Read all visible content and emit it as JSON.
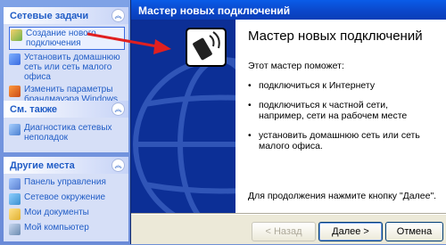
{
  "taskpane": {
    "network_tasks": {
      "title": "Сетевые задачи",
      "items": [
        {
          "label": "Создание нового подключения",
          "icon": "new-connection-icon"
        },
        {
          "label": "Установить домашнюю сеть или сеть малого офиса",
          "icon": "home-network-icon"
        },
        {
          "label": "Изменить параметры брандмауэра Windows",
          "icon": "firewall-icon"
        }
      ]
    },
    "see_also": {
      "title": "См. также",
      "items": [
        {
          "label": "Диагностика сетевых неполадок",
          "icon": "diagnostics-icon"
        }
      ]
    },
    "other_places": {
      "title": "Другие места",
      "items": [
        {
          "label": "Панель управления",
          "icon": "control-panel-icon"
        },
        {
          "label": "Сетевое окружение",
          "icon": "network-places-icon"
        },
        {
          "label": "Мои документы",
          "icon": "my-documents-icon"
        },
        {
          "label": "Мой компьютер",
          "icon": "my-computer-icon"
        }
      ]
    }
  },
  "wizard": {
    "window_title": "Мастер новых подключений",
    "heading": "Мастер новых подключений",
    "intro": "Этот мастер поможет:",
    "bullets": [
      "подключиться к Интернету",
      "подключиться к частной сети, например, сети на рабочем месте",
      "установить домашнюю сеть или сеть малого офиса."
    ],
    "footer": "Для продолжения нажмите кнопку \"Далее\".",
    "buttons": {
      "back": "< Назад",
      "next": "Далее >",
      "cancel": "Отмена"
    }
  },
  "colors": {
    "accent": "#215dc6",
    "wizard_side": "#0c2f96",
    "arrow": "#e02020"
  }
}
